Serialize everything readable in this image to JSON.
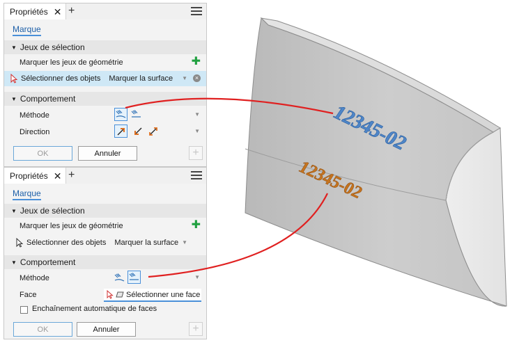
{
  "panel1": {
    "title": "Propriétés",
    "link_tab": "Marque",
    "section_selection": "Jeux de sélection",
    "mark_geometry_label": "Marquer les jeux de géométrie",
    "select_objects_label": "Sélectionner des objets",
    "select_objects_value": "Marquer la surface",
    "section_behavior": "Comportement",
    "method_label": "Méthode",
    "direction_label": "Direction",
    "ok_label": "OK",
    "cancel_label": "Annuler"
  },
  "panel2": {
    "title": "Propriétés",
    "link_tab": "Marque",
    "section_selection": "Jeux de sélection",
    "mark_geometry_label": "Marquer les jeux de géométrie",
    "select_objects_label": "Sélectionner des objets",
    "select_objects_value": "Marquer la surface",
    "section_behavior": "Comportement",
    "method_label": "Méthode",
    "face_label": "Face",
    "face_value": "Sélectionner une face",
    "auto_chain_label": "Enchaînement automatique de faces",
    "ok_label": "OK",
    "cancel_label": "Annuler"
  },
  "scene": {
    "mark_blue_text": "12345-02",
    "mark_orange_text": "12345-02"
  },
  "colors": {
    "accent": "#4a90d9",
    "link": "#1d5fa8",
    "mark_blue": "#4f86c8",
    "mark_orange": "#c5741f",
    "callout": "#e02020",
    "selected_row": "#cfe8f6",
    "add_green": "#20a040"
  },
  "icons": {
    "close": "close-icon",
    "add_tab": "plus-icon",
    "menu": "hamburger-menu-icon",
    "add_set": "green-plus-icon",
    "clear": "clear-circle-icon",
    "method_wrap": "mark-wrap-icon",
    "method_project": "mark-project-icon",
    "direction": "direction-arrow-icon",
    "cursor": "selection-cursor-icon"
  }
}
